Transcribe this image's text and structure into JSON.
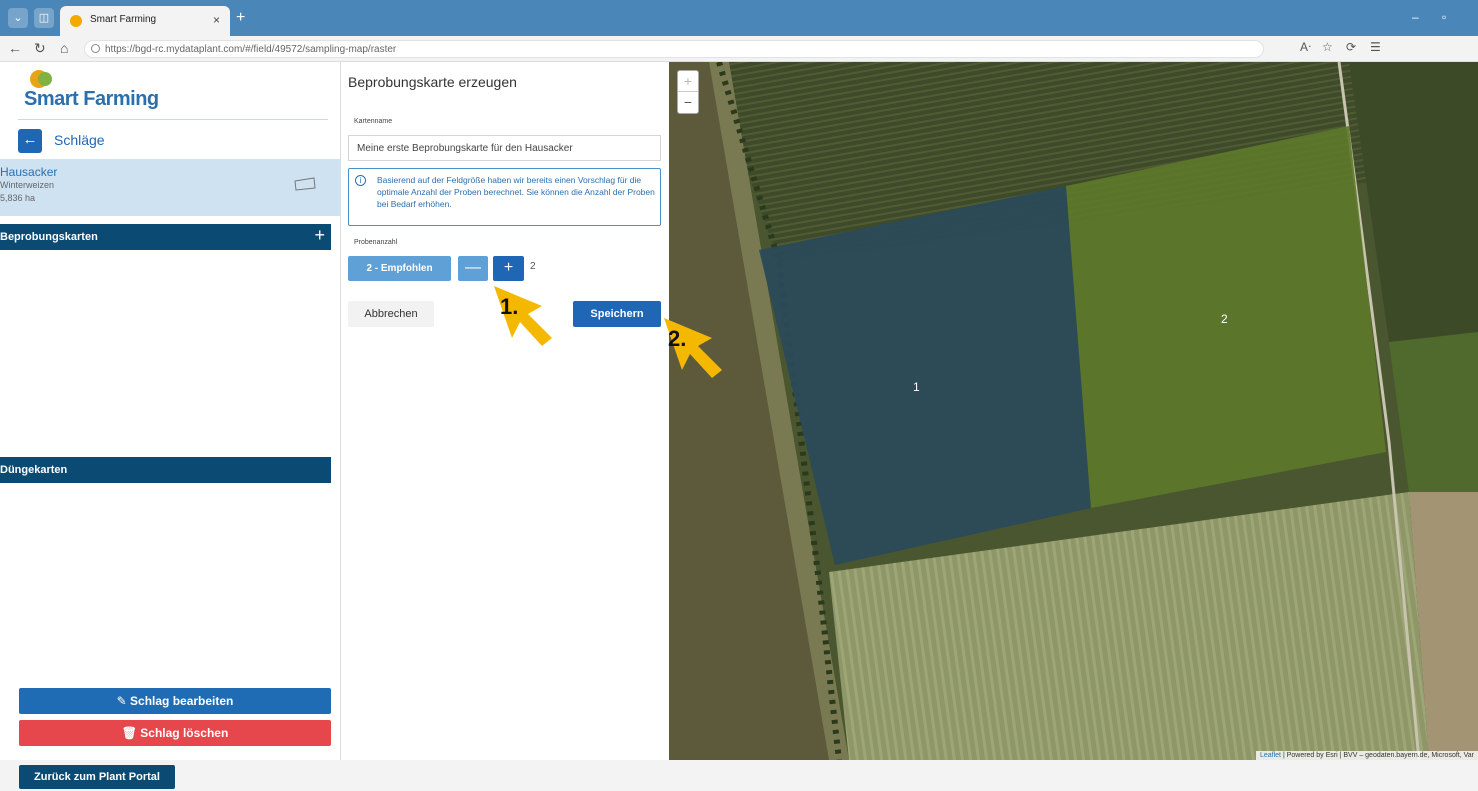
{
  "browser": {
    "tab_title": "Smart Farming",
    "url": "https://bgd-rc.mydataplant.com/#/field/49572/sampling-map/raster"
  },
  "sidebar": {
    "brand": "Smart Farming",
    "back_label": "Schläge",
    "field": {
      "name": "Hausacker",
      "crop": "Winterweizen",
      "area": "5,836 ha"
    },
    "sections": [
      {
        "label": "Beprobungskarten",
        "plus": "+"
      },
      {
        "label": "Düngekarten"
      }
    ],
    "edit_button": "Schlag bearbeiten",
    "delete_button": "Schlag löschen"
  },
  "form": {
    "title": "Beprobungskarte erzeugen",
    "name_label": "Kartenname",
    "name_value": "Meine erste Beprobungskarte für den Hausacker",
    "info_text": "Basierend auf der Feldgröße haben wir bereits einen Vorschlag für die optimale Anzahl der Proben berechnet. Sie können die Anzahl der Proben bei Bedarf erhöhen.",
    "count_label": "Probenanzahl",
    "recommend_button": "2 - Empfohlen",
    "minus": "—",
    "plus": "+",
    "count_value": "2",
    "cancel_button": "Abbrechen",
    "save_button": "Speichern"
  },
  "map": {
    "zone_labels": [
      "1",
      "2"
    ],
    "zone_colors": [
      "#2a4a5a",
      "#5d7a2a"
    ],
    "zoom_in": "+",
    "zoom_out": "−",
    "attribution_link": "Leaflet",
    "attribution_text": "| Powered by Esri | BVV – geodaten.bayern.de, Microsoft, Var"
  },
  "footer": {
    "portal_button": "Zurück zum Plant Portal"
  },
  "callouts": [
    "1.",
    "2."
  ],
  "colors": {
    "accent": "#1f66b5",
    "header_dark": "#0b4a72",
    "danger": "#e5474d",
    "callout_arrow": "#f5b800"
  }
}
